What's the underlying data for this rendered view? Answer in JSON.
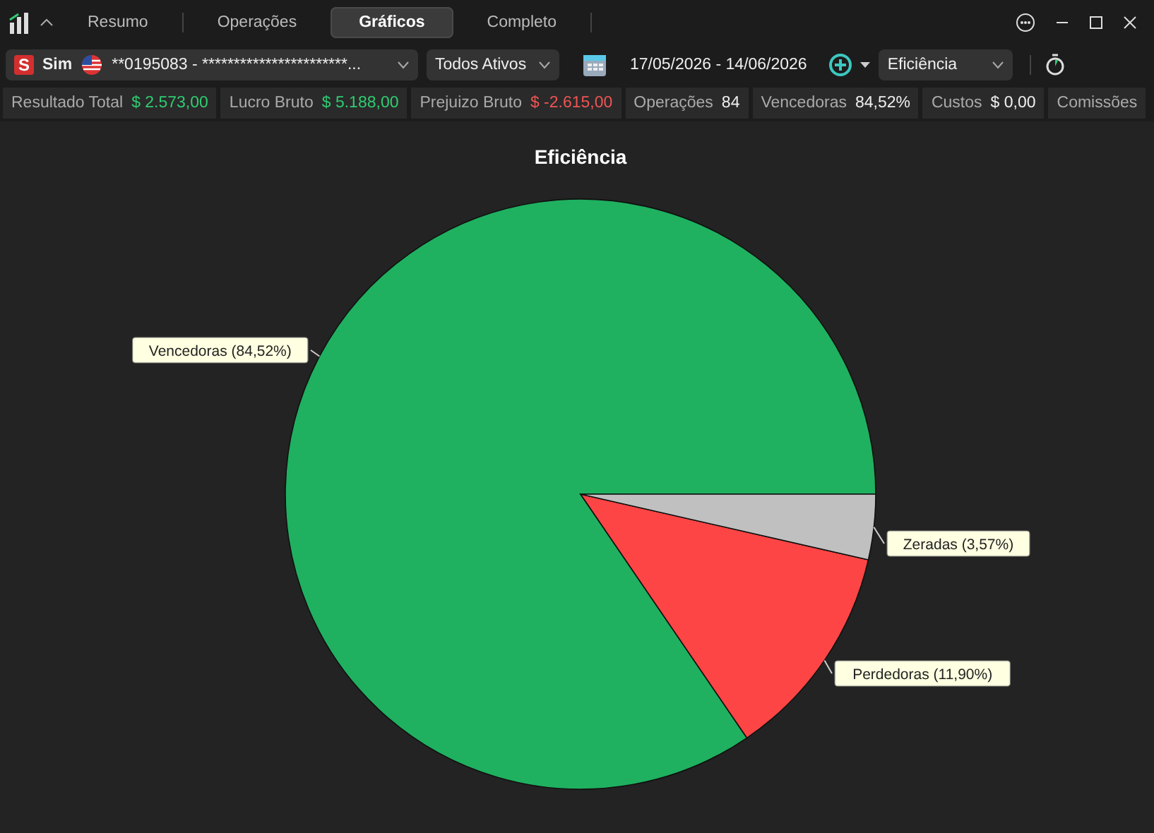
{
  "tabs": [
    {
      "label": "Resumo",
      "selected": false
    },
    {
      "label": "Operações",
      "selected": false
    },
    {
      "label": "Gráficos",
      "selected": true
    },
    {
      "label": "Completo",
      "selected": false
    }
  ],
  "toolbar": {
    "account_badge": "S",
    "account_type": "Sim",
    "account": "**0195083 - ***********************...",
    "assets": "Todos Ativos",
    "date_range": "17/05/2026 - 14/06/2026",
    "chart_select": "Eficiência"
  },
  "stats": [
    {
      "label": "Resultado Total",
      "value": "$ 2.573,00",
      "color": "#2ecc71"
    },
    {
      "label": "Lucro Bruto",
      "value": "$ 5.188,00",
      "color": "#2ecc71"
    },
    {
      "label": "Prejuizo Bruto",
      "value": "$ -2.615,00",
      "color": "#f05454"
    },
    {
      "label": "Operações",
      "value": "84",
      "color": "#eeeeee"
    },
    {
      "label": "Vencedoras",
      "value": "84,52%",
      "color": "#eeeeee"
    },
    {
      "label": "Custos",
      "value": "$ 0,00",
      "color": "#eeeeee"
    },
    {
      "label": "Comissões"
    }
  ],
  "chart": {
    "chart_data": {
      "type": "pie",
      "title": "Eficiência",
      "categories": [
        "Vencedoras",
        "Perdedoras",
        "Zeradas"
      ],
      "series": [
        {
          "values": [
            84.52,
            11.9,
            3.57
          ]
        }
      ],
      "colors": [
        "#1fb160",
        "#fe4545",
        "#c0c0c0"
      ],
      "value_labels": [
        "(84,52%)",
        "(11,90%)",
        "(3,57%)"
      ]
    }
  }
}
